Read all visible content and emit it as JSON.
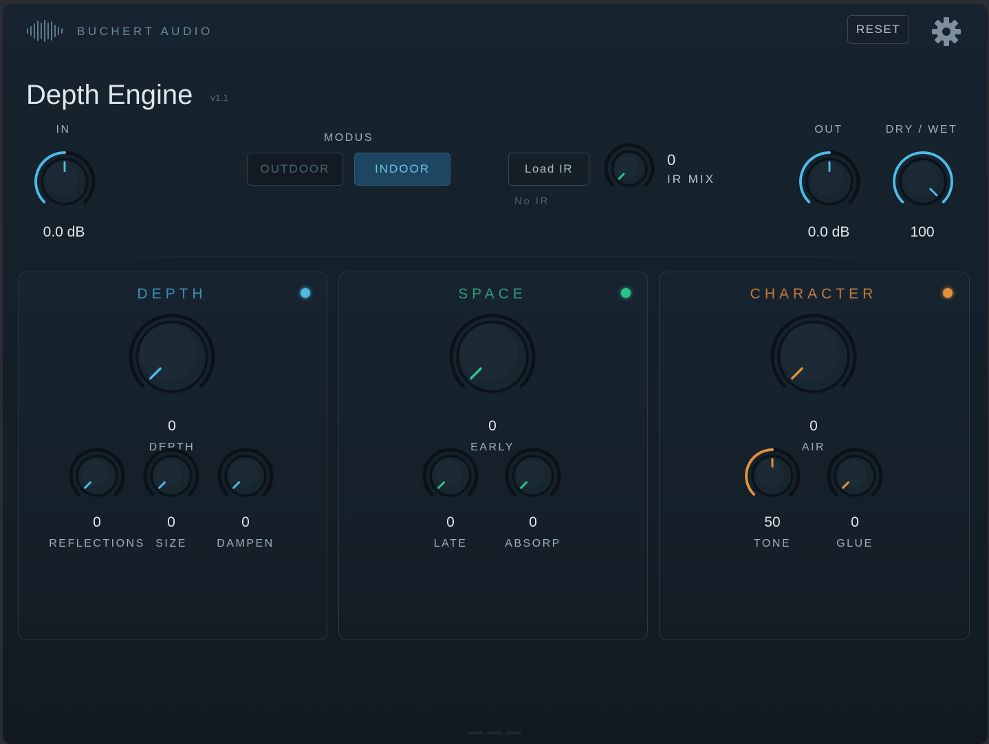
{
  "header": {
    "brand": "BUCHERT AUDIO",
    "reset_label": "RESET",
    "title": "Depth Engine",
    "version": "v1.1"
  },
  "colors": {
    "blue": "#4fb8e6",
    "green": "#2bc48d",
    "orange": "#e0913c",
    "depth_title": "#3d8fb4",
    "space_title": "#2f9d78",
    "character_title": "#c57a3a"
  },
  "top": {
    "in": {
      "label": "IN",
      "value": "0.0 dB",
      "level": 0.5
    },
    "modus": {
      "label": "MODUS",
      "options": [
        "OUTDOOR",
        "INDOOR"
      ],
      "selected": "INDOOR"
    },
    "load_ir": {
      "label": "Load IR",
      "status": "No IR"
    },
    "ir_mix": {
      "label": "IR MIX",
      "value": "0",
      "level": 0
    },
    "out": {
      "label": "OUT",
      "value": "0.0 dB",
      "level": 0.5
    },
    "dry_wet": {
      "label": "DRY / WET",
      "value": "100",
      "level": 1
    }
  },
  "panels": {
    "depth": {
      "title": "DEPTH",
      "main": {
        "label": "DEPTH",
        "value": "0",
        "level": 0
      },
      "knobs": [
        {
          "label": "REFLECTIONS",
          "value": "0",
          "level": 0
        },
        {
          "label": "SIZE",
          "value": "0",
          "level": 0
        },
        {
          "label": "DAMPEN",
          "value": "0",
          "level": 0
        }
      ]
    },
    "space": {
      "title": "SPACE",
      "main": {
        "label": "EARLY",
        "value": "0",
        "level": 0
      },
      "knobs": [
        {
          "label": "LATE",
          "value": "0",
          "level": 0
        },
        {
          "label": "ABSORP",
          "value": "0",
          "level": 0
        }
      ]
    },
    "character": {
      "title": "CHARACTER",
      "main": {
        "label": "AIR",
        "value": "0",
        "level": 0
      },
      "knobs": [
        {
          "label": "TONE",
          "value": "50",
          "level": 0.5
        },
        {
          "label": "GLUE",
          "value": "0",
          "level": 0
        }
      ]
    }
  }
}
